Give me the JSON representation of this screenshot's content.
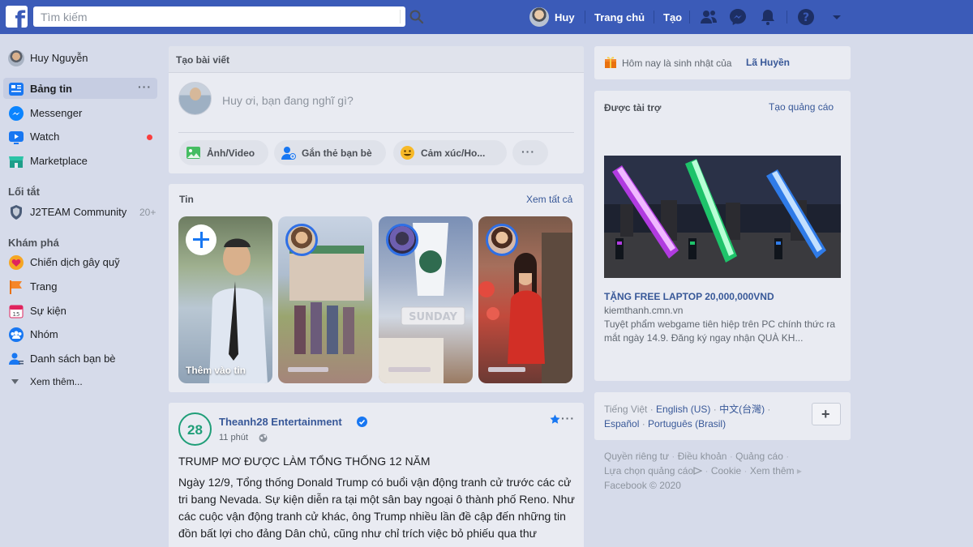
{
  "topbar": {
    "search_placeholder": "Tìm kiếm",
    "profile_name": "Huy",
    "home_label": "Trang chủ",
    "create_label": "Tạo"
  },
  "sidebar": {
    "user_name": "Huy Nguyễn",
    "main_items": [
      {
        "label": "Bảng tin"
      },
      {
        "label": "Messenger"
      },
      {
        "label": "Watch"
      },
      {
        "label": "Marketplace"
      }
    ],
    "shortcuts_heading": "Lối tắt",
    "shortcuts": [
      {
        "label": "J2TEAM Community",
        "count": "20+"
      }
    ],
    "explore_heading": "Khám phá",
    "explore_items": [
      {
        "label": "Chiến dịch gây quỹ"
      },
      {
        "label": "Trang"
      },
      {
        "label": "Sự kiện"
      },
      {
        "label": "Nhóm"
      },
      {
        "label": "Danh sách bạn bè"
      }
    ],
    "see_more": "Xem thêm..."
  },
  "composer": {
    "title": "Tạo bài viết",
    "placeholder": "Huy ơi, bạn đang nghĩ gì?",
    "actions": [
      {
        "label": "Ảnh/Video"
      },
      {
        "label": "Gắn thẻ bạn bè"
      },
      {
        "label": "Cảm xúc/Ho..."
      }
    ]
  },
  "stories": {
    "title": "Tin",
    "see_all": "Xem tất cả",
    "add_label": "Thêm vào tin"
  },
  "post": {
    "page_name": "Theanh28 Entertainment",
    "logo_text": "28",
    "time": "11 phút",
    "headline": "TRUMP MƠ ĐƯỢC LÀM TỔNG THỐNG 12 NĂM",
    "body": "Ngày 12/9, Tổng thống Donald Trump có buổi vận động tranh cử trước các cử tri bang Nevada. Sự kiện diễn ra tại một sân bay ngoại ô thành phố Reno. Như các cuộc vận động tranh cử khác, ông Trump nhiều lần đề cập đến những tin đồn bất lợi cho đảng Dân chủ, cũng như chỉ trích việc bỏ phiếu qua thư"
  },
  "birthday": {
    "prefix": "Hôm nay là sinh nhật của",
    "name": "Lã Huyền"
  },
  "sponsored": {
    "title": "Được tài trợ",
    "create_ad": "Tạo quảng cáo",
    "ad_headline": "TẶNG FREE LAPTOP 20,000,000VND",
    "ad_domain": "kiemthanh.cmn.vn",
    "ad_text": "Tuyệt phẩm webgame tiên hiệp trên PC chính thức ra mắt ngày 14.9. Đăng ký ngay nhận QUÀ KH..."
  },
  "languages": {
    "items": [
      "Tiếng Việt",
      "English (US)",
      "中文(台灣)",
      "Español",
      "Português (Brasil)"
    ]
  },
  "footer": {
    "links": [
      "Quyền riêng tư",
      "Điều khoản",
      "Quảng cáo",
      "Lựa chọn quảng cáo",
      "Cookie",
      "Xem thêm"
    ],
    "copyright": "Facebook © 2020"
  },
  "colors": {
    "topbar": "#3b5bb8",
    "link": "#385898",
    "notification_dot": "#fa3e3e",
    "page_logo": "#1f9e78"
  }
}
